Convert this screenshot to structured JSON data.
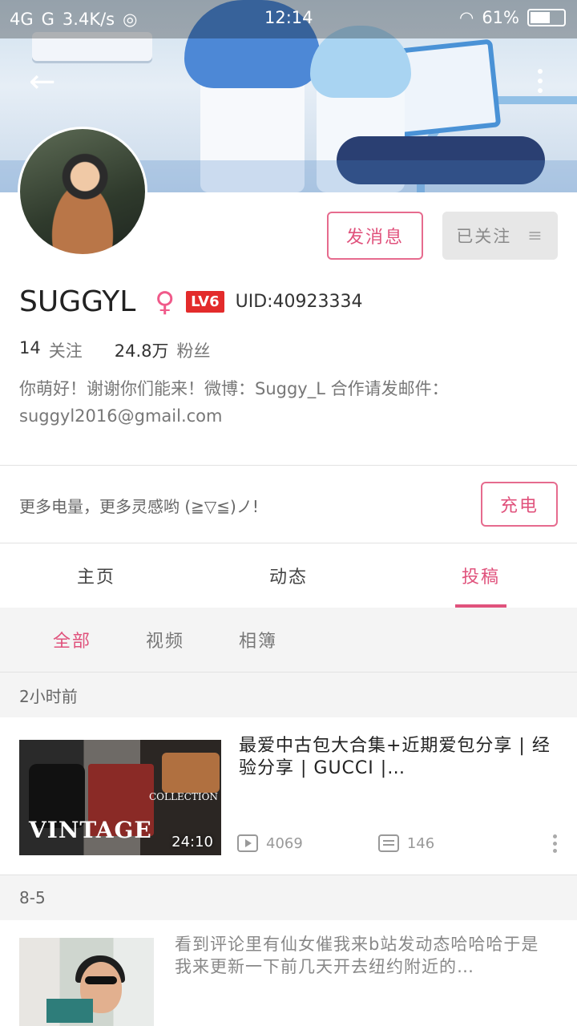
{
  "status_bar": {
    "network1": "4G",
    "network2": "G",
    "speed": "3.4K/s",
    "time": "12:14",
    "battery": "61%"
  },
  "profile": {
    "name": "SUGGYL",
    "gender_symbol": "♀",
    "level": "LV6",
    "uid": "UID:40923334",
    "following_count": "14",
    "following_label": "关注",
    "fans_count": "24.8万",
    "fans_label": "粉丝",
    "bio": "你萌好！谢谢你们能来！微博：Suggy_L 合作请发邮件：suggyl2016@gmail.com"
  },
  "actions": {
    "message": "发消息",
    "followed": "已关注",
    "followed_menu_icon": "≡"
  },
  "charge": {
    "text": "更多电量，更多灵感哟 (≧▽≦)ノ!",
    "button": "充电"
  },
  "tabs": [
    {
      "label": "主页",
      "active": false
    },
    {
      "label": "动态",
      "active": false
    },
    {
      "label": "投稿",
      "active": true
    }
  ],
  "subtabs": [
    {
      "label": "全部",
      "active": true
    },
    {
      "label": "视频",
      "active": false
    },
    {
      "label": "相簿",
      "active": false
    }
  ],
  "sections": [
    {
      "time": "2小时前",
      "title": "最爱中古包大合集+近期爱包分享 | 经验分享 | GUCCI |…",
      "duration": "24:10",
      "plays": "4069",
      "comments": "146",
      "thumb_text_main": "VINTAGE",
      "thumb_text_sub": "COLLECTION"
    },
    {
      "time": "8-5",
      "text": "看到评论里有仙女催我来b站发动态哈哈哈于是我来更新一下前几天开去纽约附近的…"
    }
  ],
  "colors": {
    "accent": "#e0527c",
    "level_badge": "#e32b2b",
    "gender": "#f05a8a"
  }
}
